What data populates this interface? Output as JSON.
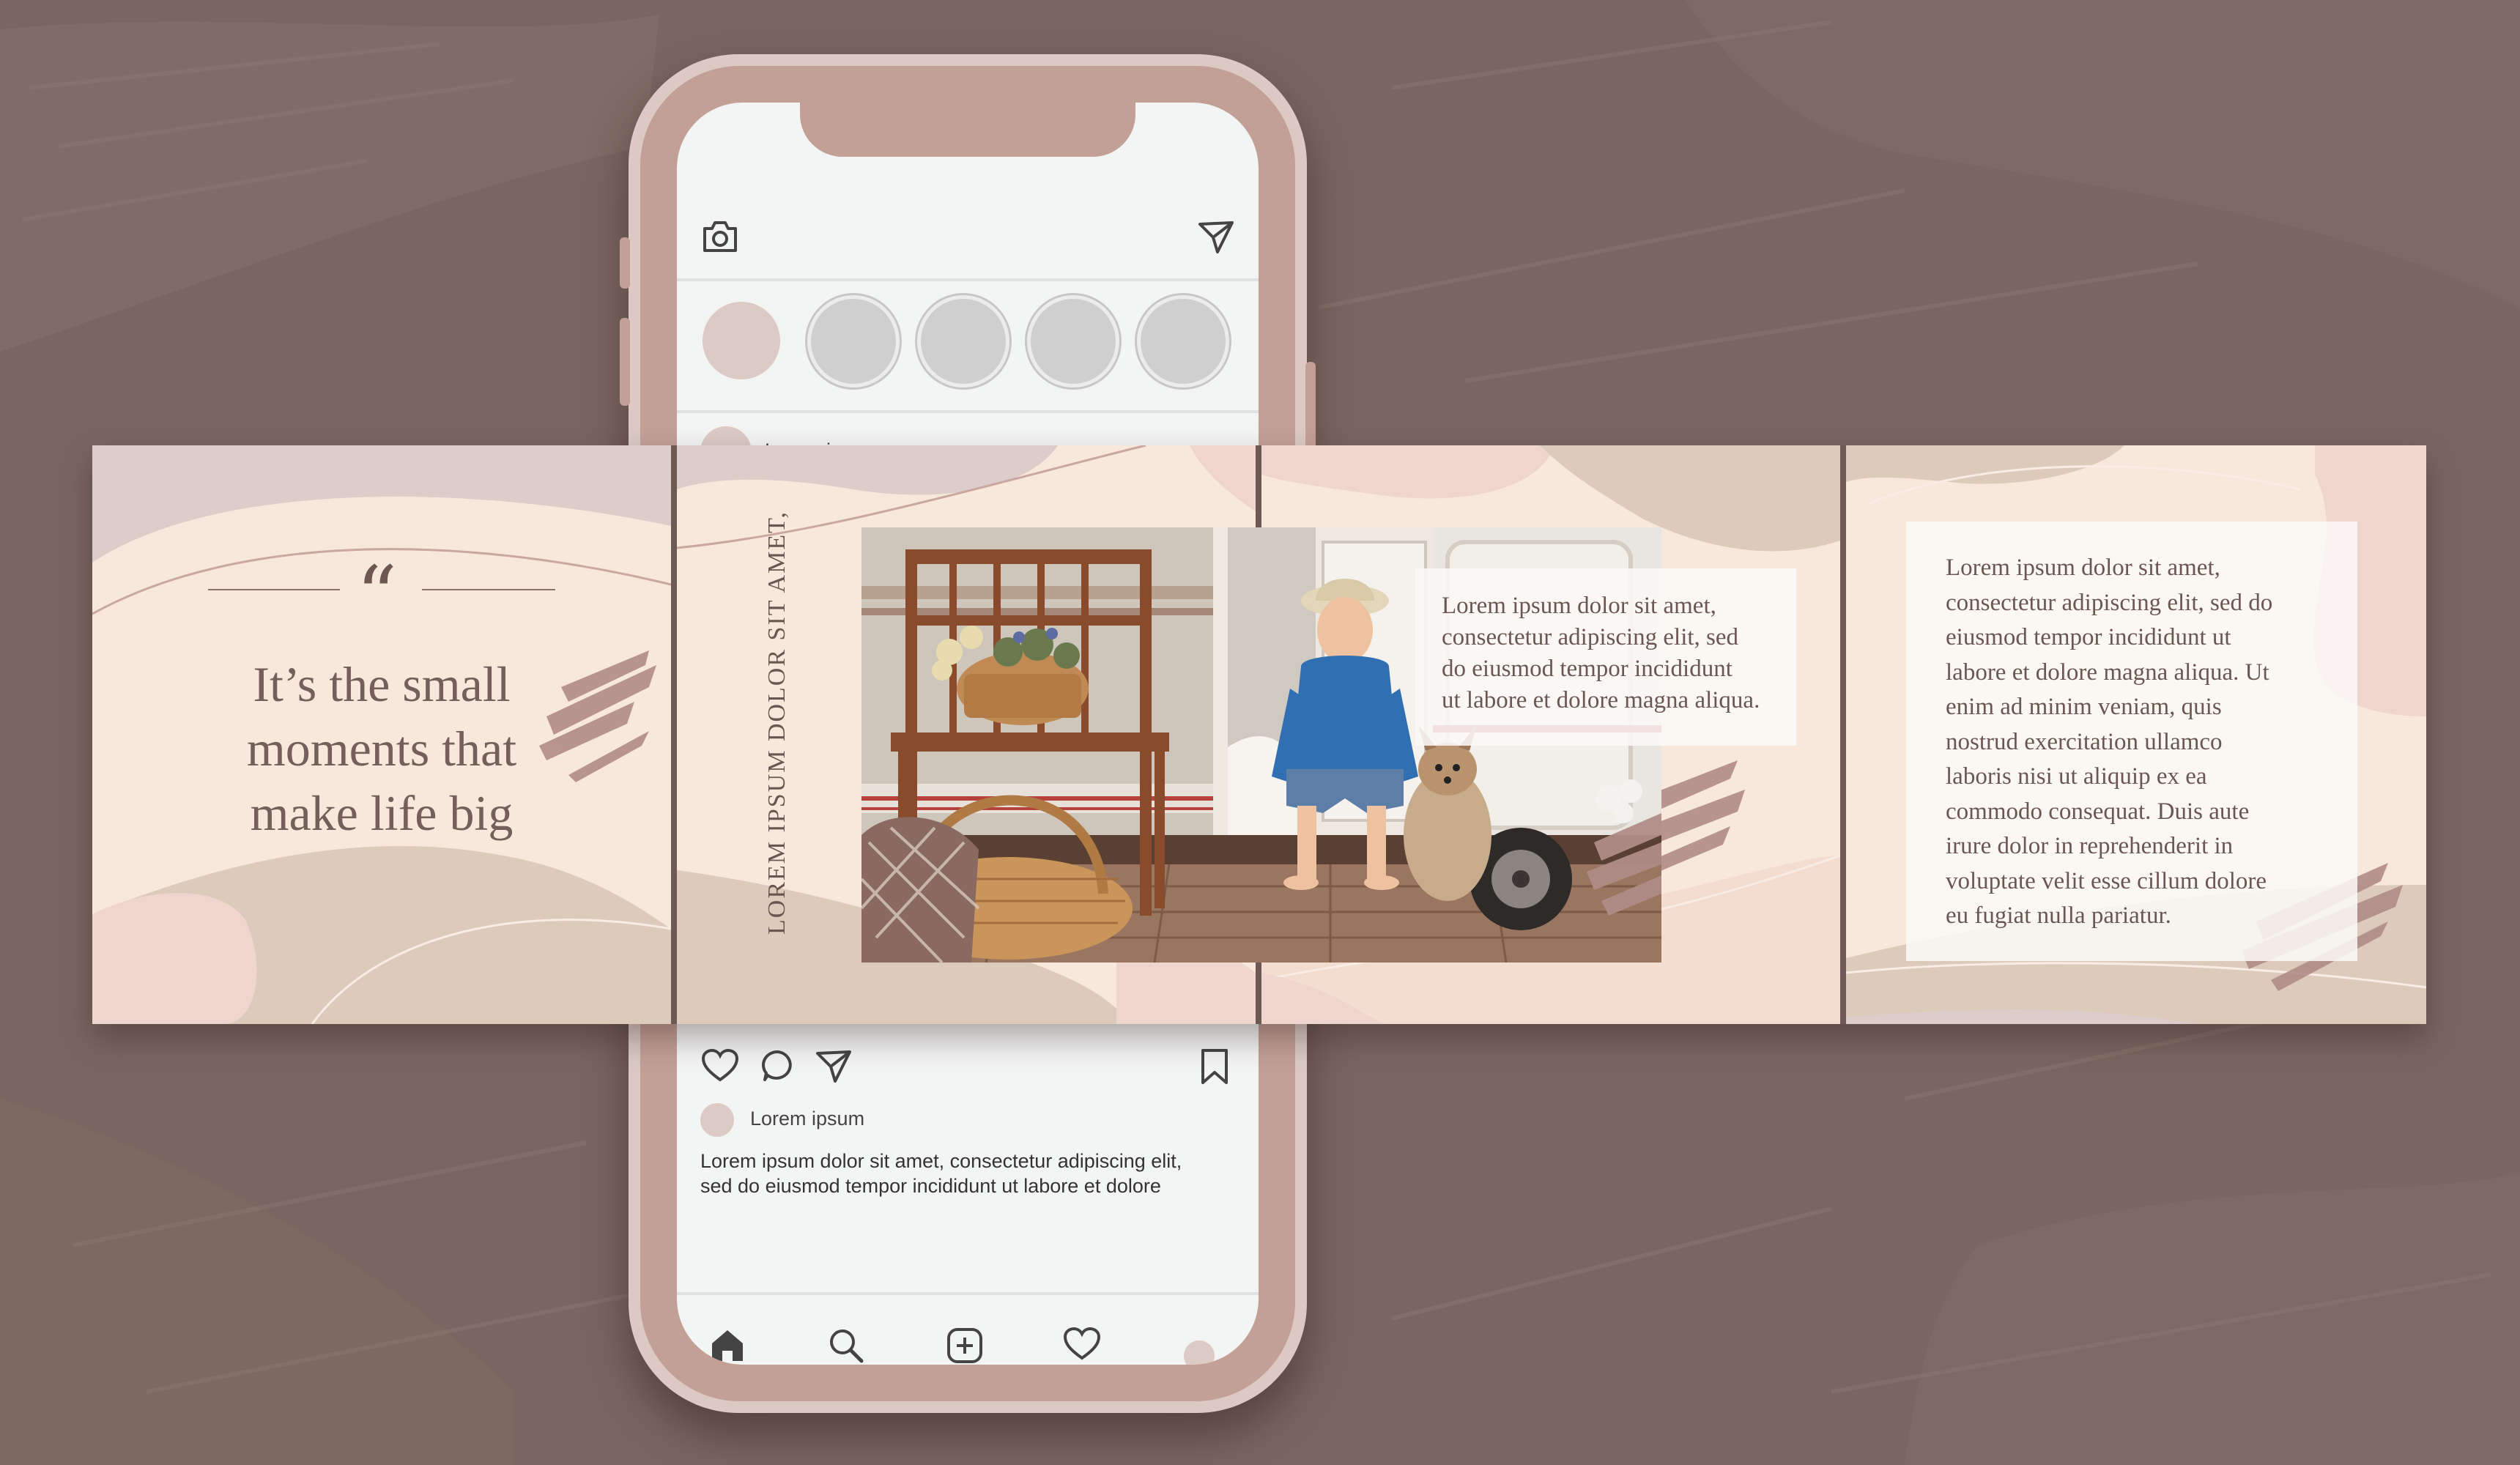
{
  "colors": {
    "background": "#7a6560",
    "phone_frame": "#c2a096",
    "cream": "#f8e8dc",
    "beige": "#dccabb",
    "blush": "#efd5cd",
    "mauve_brush": "#b08c87",
    "text": "#6a5751"
  },
  "phone": {
    "header": {
      "camera_icon": "camera-icon",
      "send_icon": "send-icon"
    },
    "post": {
      "username": "Lorem ipsum",
      "more_icon": "ellipsis-icon"
    },
    "actions": {
      "icons": [
        "heart-icon",
        "comment-icon",
        "share-icon",
        "bookmark-icon"
      ],
      "username": "Lorem ipsum",
      "caption_line1": "Lorem ipsum dolor sit amet, consectetur adipiscing elit,",
      "caption_line2": "sed do eiusmod tempor incididunt ut labore et dolore"
    },
    "tabbar": [
      "home-icon",
      "search-icon",
      "add-icon",
      "heart-icon",
      "profile-icon"
    ]
  },
  "slides": {
    "slide1": {
      "quote_mark": "“",
      "line1": "It’s the small",
      "line2": "moments that",
      "line3": "make life big"
    },
    "slide2": {
      "vertical_text": "LOREM IPSUM DOLOR SIT AMET,"
    },
    "slide3": {
      "line1": "Lorem ipsum dolor sit amet,",
      "line2": "consectetur adipiscing elit, sed",
      "line3": "do eiusmod tempor incididunt",
      "line4": "ut labore et dolore magna aliqua."
    },
    "slide4": {
      "lines": [
        "Lorem ipsum dolor sit amet,",
        "consectetur adipiscing elit, sed do",
        "eiusmod tempor incididunt ut",
        "labore et dolore magna aliqua. Ut",
        "enim ad minim veniam, quis",
        "nostrud exercitation ullamco",
        "laboris nisi ut aliquip ex ea",
        "commodo consequat. Duis aute",
        "irure dolor in reprehenderit in",
        "voluptate velit esse cillum dolore",
        "eu fugiat nulla pariatur."
      ]
    }
  }
}
